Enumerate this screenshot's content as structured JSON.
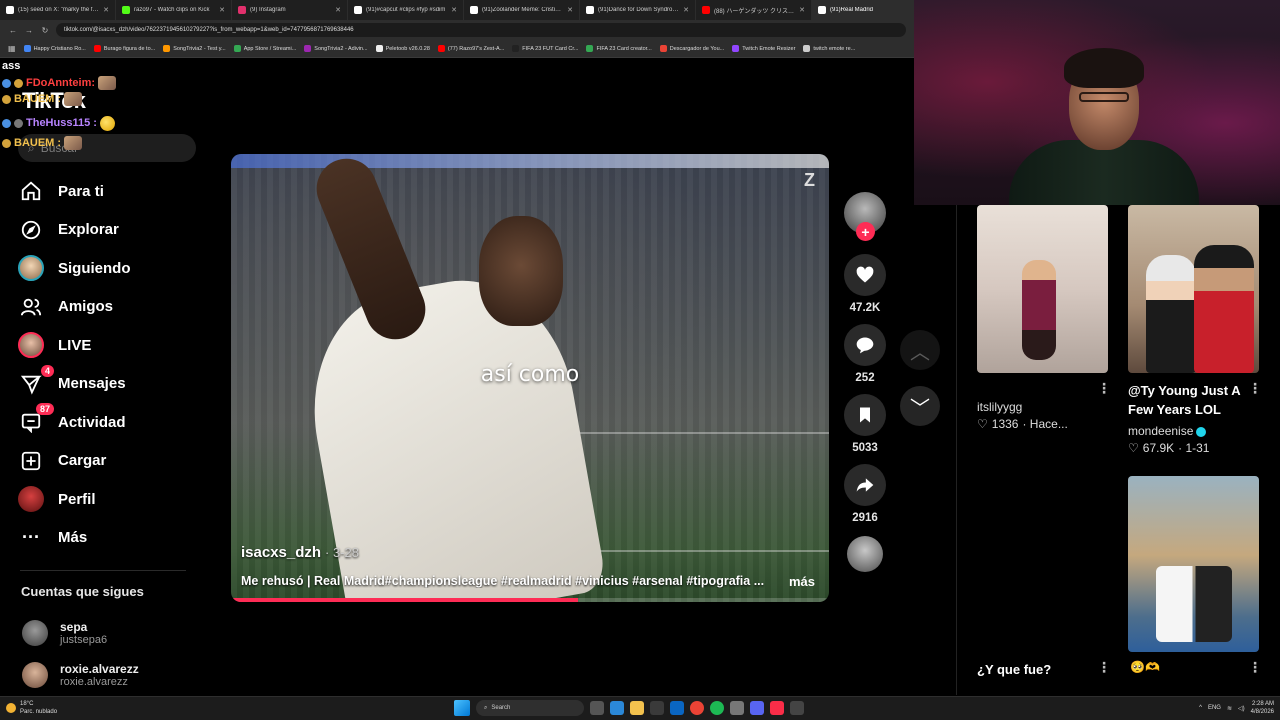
{
  "browser": {
    "tabs": [
      {
        "title": "(15) seed on X: \"marky the first\"",
        "color": "#ffffff"
      },
      {
        "title": "razo97 - Watch clips on Kick",
        "color": "#53fc18"
      },
      {
        "title": "(9) Instagram",
        "color": "#e1306c"
      },
      {
        "title": "(91)#capcut #clips #fyp #sdim",
        "color": "#ffffff"
      },
      {
        "title": "(91)Zoolander Meme: Cristiano",
        "color": "#ffffff"
      },
      {
        "title": "(91)Dance for Down Syndrome",
        "color": "#ffffff"
      },
      {
        "title": "(88) ハーゲンダッツ クリスピーサンド",
        "color": "#ff0000"
      },
      {
        "title": "(91)Real Madrid",
        "color": "#ffffff"
      }
    ],
    "url": "tiktok.com/@isacxs_dzh/video/7622371945610279227?is_from_webapp=1&web_id=7477956871769638446",
    "bookmarks": [
      {
        "label": "Happy Cristiano Ro...",
        "color": "#4285f4"
      },
      {
        "label": "Burago figura de to...",
        "color": "#ff0000"
      },
      {
        "label": "SongTrivia2 - Test y...",
        "color": "#ff9800"
      },
      {
        "label": "App Store / Streami...",
        "color": "#34a853"
      },
      {
        "label": "SongTrivia2 - Adivin...",
        "color": "#9c27b0"
      },
      {
        "label": "Peletoob v26.0.28",
        "color": "#eeeeee"
      },
      {
        "label": "(77) Razo97's Zest-A...",
        "color": "#ff0000"
      },
      {
        "label": "FIFA 23 FUT Card Cr...",
        "color": "#222222"
      },
      {
        "label": "FIFA 23 Card creator...",
        "color": "#34a853"
      },
      {
        "label": "Descargador de You...",
        "color": "#ea4335"
      },
      {
        "label": "Twitch Emote Resizer",
        "color": "#9146ff"
      },
      {
        "label": "twitch emote re...",
        "color": "#cccccc"
      }
    ]
  },
  "chat": {
    "header": "ass",
    "lines": [
      {
        "user": "FDoAnnteim:",
        "color": "#ff4040"
      },
      {
        "user": "BAUEM :",
        "color": "#f2c14e"
      },
      {
        "user": "TheHuss115 :",
        "color": "#b884ff"
      },
      {
        "user": "BAUEM :",
        "color": "#f2c14e"
      }
    ]
  },
  "tiktok": {
    "logo": "TikTok",
    "search_placeholder": "Buscar",
    "nav": [
      {
        "label": "Para ti",
        "icon": "home-icon"
      },
      {
        "label": "Explorar",
        "icon": "compass-icon"
      },
      {
        "label": "Siguiendo",
        "icon": "following-avatar"
      },
      {
        "label": "Amigos",
        "icon": "friends-icon"
      },
      {
        "label": "LIVE",
        "icon": "live-avatar"
      },
      {
        "label": "Mensajes",
        "icon": "send-icon",
        "badge": "4"
      },
      {
        "label": "Actividad",
        "icon": "inbox-icon",
        "badge": "87"
      },
      {
        "label": "Cargar",
        "icon": "upload-icon"
      },
      {
        "label": "Perfil",
        "icon": "profile-avatar"
      },
      {
        "label": "Más",
        "icon": "more-icon"
      }
    ],
    "following_title": "Cuentas que sigues",
    "following": [
      {
        "name": "sepa",
        "handle": "justsepa6"
      },
      {
        "name": "roxie.alvarezz",
        "handle": "roxie.alvarezz"
      }
    ]
  },
  "video": {
    "caption": "así como",
    "watermark": "Z",
    "author": "isacxs_dzh",
    "date": "· 3-28",
    "description": "Me rehusó | Real Madrid#championsleague #realmadrid #vinicius #arsenal #tipografia ...",
    "more": "más",
    "progress": 0.58,
    "likes": "47.2K",
    "comments": "252",
    "saves": "5033",
    "shares": "2916",
    "follow_symbol": "+"
  },
  "feed": {
    "cards": [
      {
        "user": "itslilyygg",
        "likes": "1336",
        "time": "· Hace..."
      },
      {
        "title": "@Ty Young Just A Few Years LOL",
        "user": "mondeenise",
        "likes": "67.9K",
        "time": "· 1-31"
      },
      {
        "title": "¿Y que fue?"
      }
    ],
    "more_symbol": "⋮"
  },
  "taskbar": {
    "temp": "18°C",
    "weather": "Parc. nublado",
    "search": "Search",
    "lang": "ENG",
    "time": "2:28 AM",
    "date": "4/8/2026"
  },
  "colors": {
    "accent": "#fe2c55",
    "bg": "#000000"
  }
}
